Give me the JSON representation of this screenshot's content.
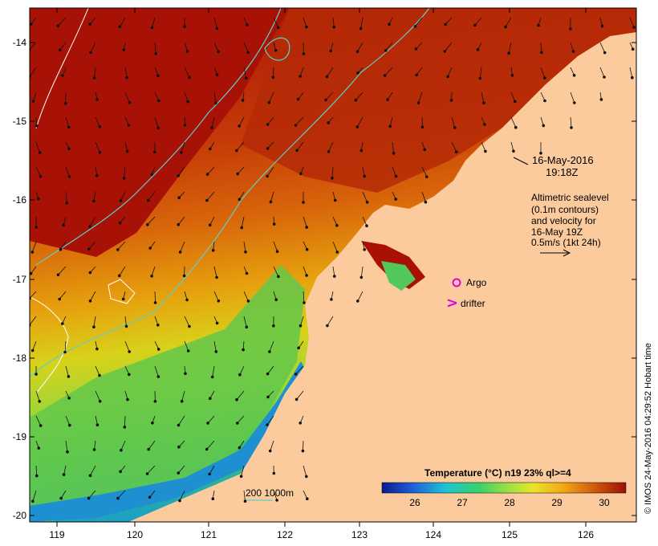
{
  "colors": {
    "land": "#FBCB9E",
    "deep_sea": "#A81206",
    "contour": "#5ECFC9",
    "bathy": "#FFFFFF",
    "argo": "#E000E0",
    "drifter": "#E000E0"
  },
  "axes": {
    "x_ticks": [
      "119",
      "120",
      "121",
      "122",
      "123",
      "124",
      "125",
      "126"
    ],
    "y_ticks": [
      "-14",
      "-15",
      "-16",
      "-17",
      "-18",
      "-19",
      "-20"
    ]
  },
  "annotations": {
    "date": "16-May-2016",
    "time": "19:18Z",
    "legend_lines": [
      "Altimetric sealevel",
      "(0.1m contours)",
      "and velocity for",
      "16-May 19Z",
      "0.5m/s (1kt 24h)"
    ],
    "argo": "Argo",
    "drifter": "drifter",
    "drifter_symbol": ">",
    "bathy_scale": "200  1000m",
    "copyright": "© IMOS 24-May-2016 04:29:52 Hobart time"
  },
  "colorbar": {
    "title": "Temperature (°C) n19 23% ql>=4",
    "ticks": [
      "26",
      "27",
      "28",
      "29",
      "30"
    ]
  }
}
